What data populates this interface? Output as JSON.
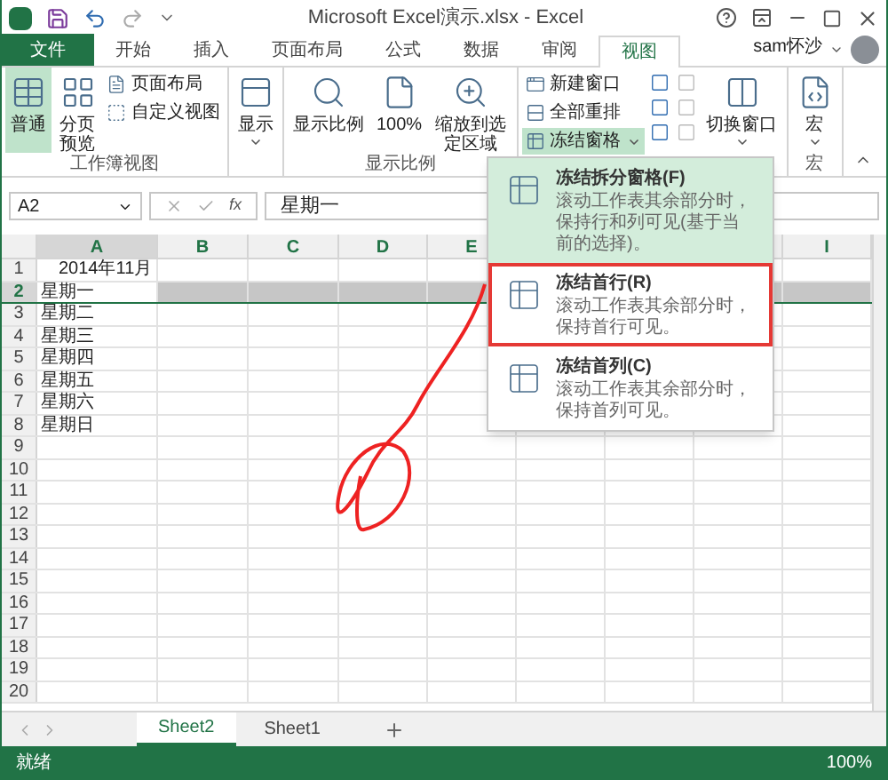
{
  "window": {
    "title": "Microsoft Excel演示.xlsx - Excel"
  },
  "ribbon_tabs": [
    {
      "label": "文件",
      "kind": "file",
      "selected": false
    },
    {
      "label": "开始",
      "kind": "tab",
      "selected": false
    },
    {
      "label": "插入",
      "kind": "tab",
      "selected": false
    },
    {
      "label": "页面布局",
      "kind": "tab",
      "selected": false
    },
    {
      "label": "公式",
      "kind": "tab",
      "selected": false
    },
    {
      "label": "数据",
      "kind": "tab",
      "selected": false
    },
    {
      "label": "审阅",
      "kind": "tab",
      "selected": false
    },
    {
      "label": "视图",
      "kind": "tab",
      "selected": true
    }
  ],
  "user": {
    "name": "sam怀沙"
  },
  "ribbon_groups": [
    {
      "label": "工作簿视图",
      "buttons": [
        {
          "label": "普通",
          "kind": "large",
          "selected": true
        },
        {
          "label": "分页预览",
          "kind": "large",
          "selected": false
        },
        {
          "label": "页面布局",
          "kind": "small",
          "selected": false
        },
        {
          "label": "自定义视图",
          "kind": "small",
          "selected": false
        }
      ]
    },
    {
      "buttons": [
        {
          "label": "显示",
          "kind": "large",
          "selected": false,
          "dropdown": true
        }
      ]
    },
    {
      "label": "显示比例",
      "buttons": [
        {
          "label": "显示比例",
          "kind": "large",
          "selected": false
        },
        {
          "label": "100%",
          "kind": "large",
          "selected": false
        },
        {
          "label": "缩放到选定区域",
          "kind": "large",
          "selected": false
        }
      ]
    },
    {
      "buttons": [
        {
          "label": "新建窗口",
          "kind": "small",
          "selected": false
        },
        {
          "label": "全部重排",
          "kind": "small",
          "selected": false
        },
        {
          "label": "冻结窗格",
          "kind": "small",
          "selected": true,
          "dropdown": true
        },
        {
          "label": "切换窗口",
          "kind": "large",
          "selected": false,
          "dropdown": true
        }
      ]
    },
    {
      "label": "宏",
      "buttons": [
        {
          "label": "宏",
          "kind": "large",
          "selected": false,
          "dropdown": true
        }
      ]
    }
  ],
  "formula_bar": {
    "name_box": "A2",
    "fx": "fx",
    "value": "星期一"
  },
  "columns": [
    "A",
    "B",
    "C",
    "D",
    "E"
  ],
  "last_column": "I",
  "rows": [
    {
      "header": "1",
      "selected": false,
      "cells": [
        "2014年11月"
      ]
    },
    {
      "header": "2",
      "selected": true,
      "cells": [
        "星期一"
      ]
    },
    {
      "header": "3",
      "selected": false,
      "cells": [
        "星期二"
      ]
    },
    {
      "header": "4",
      "selected": false,
      "cells": [
        "星期三"
      ]
    },
    {
      "header": "5",
      "selected": false,
      "cells": [
        "星期四"
      ]
    },
    {
      "header": "6",
      "selected": false,
      "cells": [
        "星期五"
      ]
    },
    {
      "header": "7",
      "selected": false,
      "cells": [
        "星期六"
      ]
    },
    {
      "header": "8",
      "selected": false,
      "cells": [
        "星期日"
      ]
    },
    {
      "header": "9",
      "selected": false,
      "cells": []
    },
    {
      "header": "10",
      "selected": false,
      "cells": []
    },
    {
      "header": "11",
      "selected": false,
      "cells": []
    },
    {
      "header": "12",
      "selected": false,
      "cells": []
    },
    {
      "header": "13",
      "selected": false,
      "cells": []
    },
    {
      "header": "14",
      "selected": false,
      "cells": []
    },
    {
      "header": "15",
      "selected": false,
      "cells": []
    },
    {
      "header": "16",
      "selected": false,
      "cells": []
    },
    {
      "header": "17",
      "selected": false,
      "cells": []
    },
    {
      "header": "18",
      "selected": false,
      "cells": []
    },
    {
      "header": "19",
      "selected": false,
      "cells": []
    },
    {
      "header": "20",
      "selected": false,
      "cells": []
    }
  ],
  "freeze_menu": {
    "items": [
      {
        "title": "冻结拆分窗格(F)",
        "description": "滚动工作表其余部分时，保持行和列可见(基于当前的选择)。",
        "selected": true,
        "outlined": false
      },
      {
        "title": "冻结首行(R)",
        "description": "滚动工作表其余部分时，保持首行可见。",
        "selected": false,
        "outlined": true
      },
      {
        "title": "冻结首列(C)",
        "description": "滚动工作表其余部分时，保持首列可见。",
        "selected": false,
        "outlined": false
      }
    ]
  },
  "sheets": [
    {
      "label": "Sheet2",
      "selected": true
    },
    {
      "label": "Sheet1",
      "selected": false
    }
  ],
  "status_bar": {
    "status": "就绪",
    "zoom": "100%"
  }
}
